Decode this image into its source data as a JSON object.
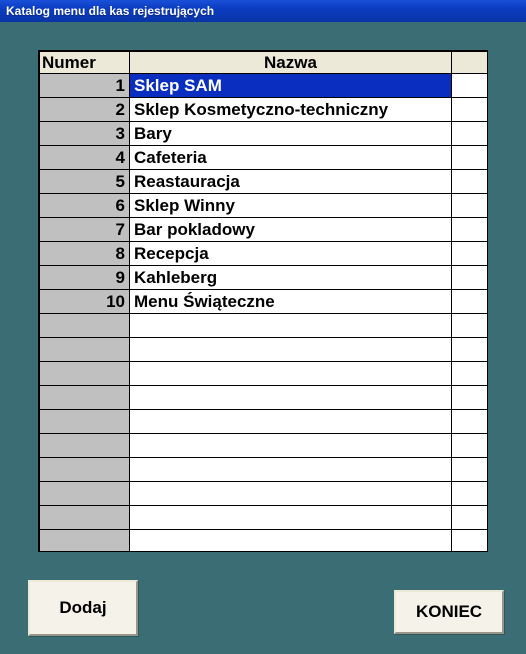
{
  "window": {
    "title": "Katalog menu dla kas rejestrujących"
  },
  "table": {
    "headers": {
      "numer": "Numer",
      "nazwa": "Nazwa"
    },
    "rows": [
      {
        "num": "1",
        "name": "Sklep SAM"
      },
      {
        "num": "2",
        "name": "Sklep Kosmetyczno-techniczny"
      },
      {
        "num": "3",
        "name": "Bary"
      },
      {
        "num": "4",
        "name": "Cafeteria"
      },
      {
        "num": "5",
        "name": "Reastauracja"
      },
      {
        "num": "6",
        "name": "Sklep Winny"
      },
      {
        "num": "7",
        "name": "Bar pokladowy"
      },
      {
        "num": "8",
        "name": "Recepcja"
      },
      {
        "num": "9",
        "name": "Kahleberg"
      },
      {
        "num": "10",
        "name": "Menu Świąteczne"
      }
    ],
    "selected_index": 0,
    "total_visible_rows": 20
  },
  "buttons": {
    "add": "Dodaj",
    "close": "KONIEC"
  }
}
